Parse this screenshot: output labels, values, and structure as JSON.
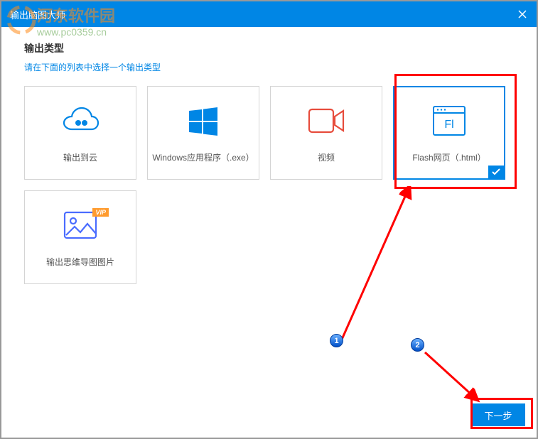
{
  "titlebar": {
    "text": "输出脑图大师"
  },
  "watermark": {
    "brand": "河东软件园",
    "url": "www.pc0359.cn"
  },
  "section": {
    "title": "输出类型",
    "instruction": "请在下面的列表中选择一个输出类型"
  },
  "cards": {
    "cloud": {
      "label": "输出到云"
    },
    "exe": {
      "label": "Windows应用程序（.exe）"
    },
    "video": {
      "label": "视频"
    },
    "flash": {
      "label": "Flash网页（.html）"
    },
    "mindmap": {
      "label": "输出思维导图图片",
      "vip": "VIP"
    }
  },
  "next_button": {
    "label": "下一步"
  },
  "annotations": {
    "step1": "1",
    "step2": "2"
  }
}
